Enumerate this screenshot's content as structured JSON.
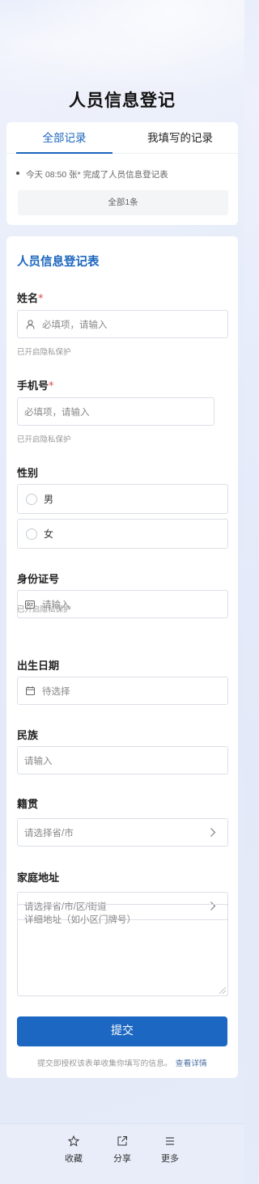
{
  "page": {
    "title": "人员信息登记"
  },
  "records": {
    "tabs": [
      {
        "label": "全部记录",
        "active": true
      },
      {
        "label": "我填写的记录",
        "active": false
      }
    ],
    "latest": "今天 08:50  张* 完成了人员信息登记表",
    "count_label": "全部1条"
  },
  "form": {
    "heading": "人员信息登记表",
    "name": {
      "label": "姓名",
      "required": "*",
      "placeholder": "必填项，请输入",
      "hint": "已开启隐私保护",
      "icon": "person-icon"
    },
    "phone": {
      "label": "手机号",
      "required": "*",
      "placeholder": "必填项，请输入",
      "hint": "已开启隐私保护"
    },
    "gender": {
      "label": "性别",
      "options": [
        "男",
        "女"
      ]
    },
    "id_card": {
      "label": "身份证号",
      "placeholder": "请输入",
      "hint": "已开启隐私保护",
      "icon": "id-card-icon"
    },
    "birth": {
      "label": "出生日期",
      "placeholder": "待选择",
      "icon": "calendar-icon"
    },
    "ethnicity": {
      "label": "民族",
      "placeholder": "请输入"
    },
    "native_place": {
      "label": "籍贯",
      "placeholder": "请选择省/市",
      "icon": "chevron-right-icon"
    },
    "address": {
      "label": "家庭地址",
      "region_placeholder": "请选择省/市/区/街道",
      "detail_placeholder": "详细地址（如小区门牌号）"
    },
    "submit_label": "提交",
    "consent": "提交即授权该表单收集你填写的信息。",
    "consent_link": "查看详情"
  },
  "bottom_bar": [
    {
      "label": "收藏",
      "icon": "star-icon"
    },
    {
      "label": "分享",
      "icon": "share-icon"
    },
    {
      "label": "更多",
      "icon": "menu-icon"
    }
  ],
  "colors": {
    "accent": "#1a65bd",
    "required": "#e04b4b",
    "button": "#1b67c1"
  }
}
